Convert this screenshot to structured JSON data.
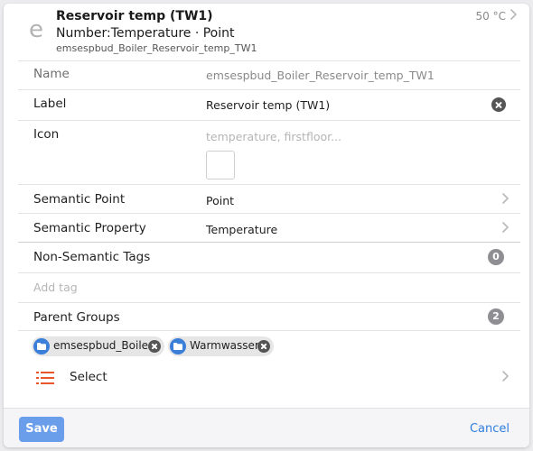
{
  "colors": {
    "accent": "#2f7de0",
    "save_button": "#6a9eea",
    "select_icon": "#e8572b",
    "folder_icon": "#3b7fd9",
    "badge": "#8e8e93"
  },
  "header": {
    "icon_letter": "e",
    "title": "Reservoir temp (TW1)",
    "subtitle": "Number:Temperature · Point",
    "item_name": "emsespbud_Boiler_Reservoir_temp_TW1",
    "state": "50 °C"
  },
  "fields": {
    "name": {
      "label": "Name",
      "value": "emsespbud_Boiler_Reservoir_temp_TW1"
    },
    "label": {
      "label": "Label",
      "value": "Reservoir temp (TW1)"
    },
    "icon": {
      "label": "Icon",
      "placeholder": "temperature, firstfloor..."
    },
    "semantic_point": {
      "label": "Semantic Point",
      "value": "Point"
    },
    "semantic_property": {
      "label": "Semantic Property",
      "value": "Temperature"
    }
  },
  "tags": {
    "label": "Non-Semantic Tags",
    "count": "0",
    "add_placeholder": "Add tag"
  },
  "groups": {
    "label": "Parent Groups",
    "count": "2",
    "chips": [
      "emsespbud_Boiler",
      "Warmwasser"
    ],
    "select_label": "Select"
  },
  "footer": {
    "save_label": "Save",
    "cancel_label": "Cancel"
  }
}
